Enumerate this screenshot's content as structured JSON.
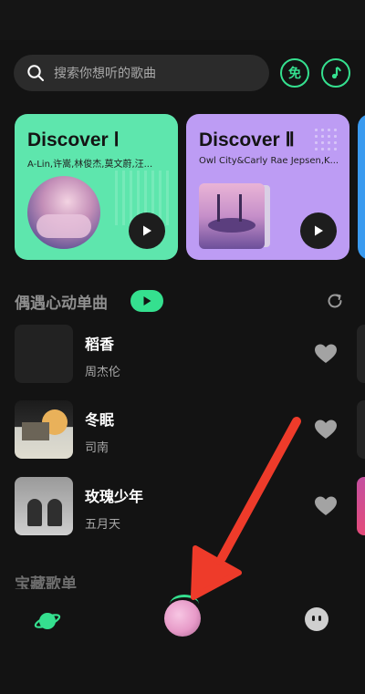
{
  "search": {
    "placeholder": "搜索你想听的歌曲"
  },
  "header": {
    "free_badge": "免"
  },
  "cards": [
    {
      "title": "Discover Ⅰ",
      "artists": "A-Lin,许嵩,林俊杰,莫文蔚,汪..."
    },
    {
      "title": "Discover Ⅱ",
      "artists": "Owl City&Carly Rae Jepsen,K..."
    }
  ],
  "section": {
    "title": "偶遇心动单曲"
  },
  "songs": [
    {
      "name": "稻香",
      "artist": "周杰伦"
    },
    {
      "name": "冬眠",
      "artist": "司南"
    },
    {
      "name": "玫瑰少年",
      "artist": "五月天"
    }
  ],
  "next_section": {
    "title": "宝藏歌单"
  },
  "colors": {
    "accent": "#35e08f",
    "card1": "#5ee6ad",
    "card2": "#bd9cf4",
    "arrow": "#ee3b2a"
  },
  "icons": [
    "search-icon",
    "free-badge-icon",
    "music-note-icon",
    "play-icon",
    "refresh-icon",
    "heart-icon",
    "planet-icon",
    "disc-icon",
    "face-icon",
    "arrow-icon"
  ]
}
